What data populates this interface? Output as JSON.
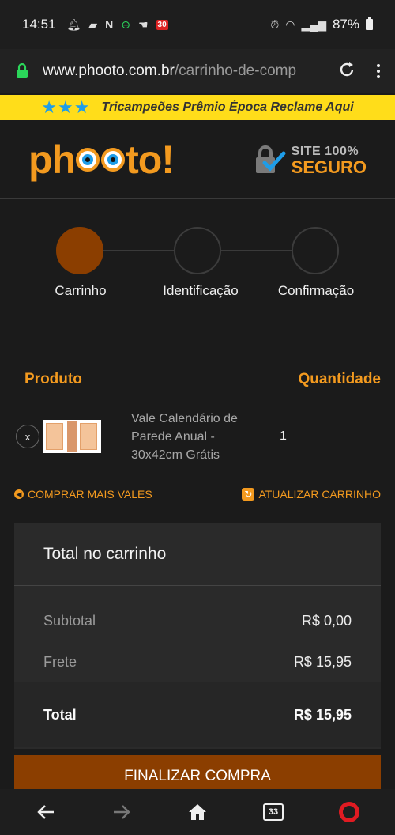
{
  "status": {
    "time": "14:51",
    "badge": "30",
    "battery": "87%"
  },
  "browser": {
    "url_main": "www.phooto.com.br",
    "url_path": "/carrinho-de-comp"
  },
  "promo": {
    "stars": "★★★",
    "text": "Tricampeões Prêmio Época Reclame Aqui"
  },
  "header": {
    "logo_pre": "ph",
    "logo_post": "to!",
    "secure_top": "SITE 100%",
    "secure_bottom": "SEGURO"
  },
  "steps": [
    {
      "label": "Carrinho",
      "active": true
    },
    {
      "label": "Identificação",
      "active": false
    },
    {
      "label": "Confirmação",
      "active": false
    }
  ],
  "cart": {
    "col_product": "Produto",
    "col_quantity": "Quantidade",
    "items": [
      {
        "remove": "x",
        "name": "Vale Calendário de Parede Anual - 30x42cm Grátis",
        "quantity": "1"
      }
    ],
    "link_more": "COMPRAR MAIS VALES",
    "link_update": "ATUALIZAR CARRINHO"
  },
  "totals": {
    "title": "Total no carrinho",
    "subtotal_label": "Subtotal",
    "subtotal_value": "R$ 0,00",
    "shipping_label": "Frete",
    "shipping_value": "R$ 15,95",
    "total_label": "Total",
    "total_value": "R$ 15,95"
  },
  "checkout_button": "FINALIZAR COMPRA",
  "nav": {
    "tab_count": "33"
  },
  "colors": {
    "accent": "#f39a1f",
    "step_active": "#8b3e00",
    "promo_bg": "#ffdd1a",
    "star_blue": "#1e9de8"
  }
}
